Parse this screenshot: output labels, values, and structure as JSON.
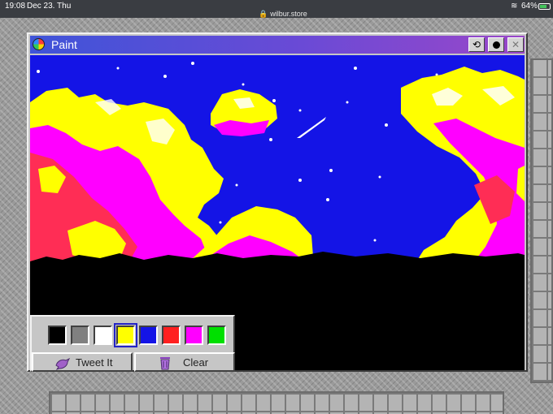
{
  "status_bar": {
    "time": "19:08",
    "date": "Dec 23. Thu",
    "url": "wilbur.store",
    "battery": "64%"
  },
  "window": {
    "title": "Paint",
    "buttons": {
      "undo_icon": "undo-icon",
      "record_icon": "record-icon",
      "close_icon": "close-icon"
    }
  },
  "palette": {
    "colors": [
      "#000000",
      "#808080",
      "#ffffff",
      "#ffff00",
      "#1414e6",
      "#ff2020",
      "#ff00ff",
      "#00e000"
    ],
    "selected_index": 3
  },
  "tools": {
    "tweet_label": "Tweet It",
    "clear_label": "Clear"
  },
  "colors": {
    "titlebar_start": "#3f54d8",
    "titlebar_end": "#9a47c9",
    "sky": "#1414e6",
    "ground": "#000000"
  }
}
